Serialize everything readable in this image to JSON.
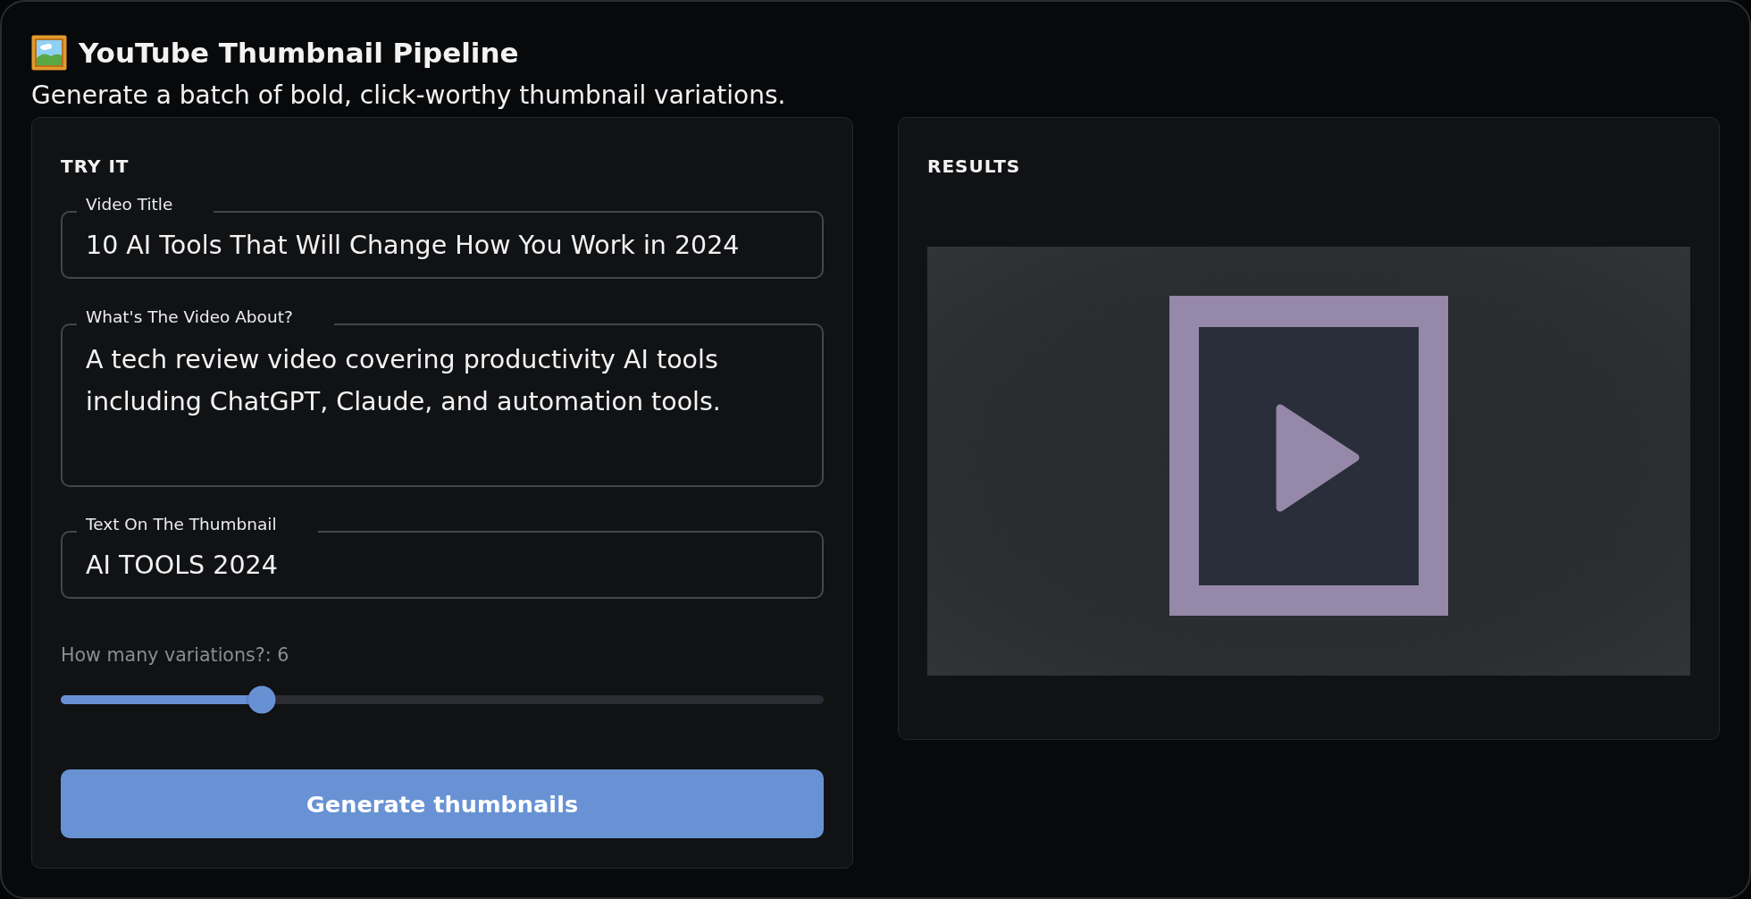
{
  "header": {
    "title": "YouTube Thumbnail Pipeline",
    "subtitle": "Generate a batch of bold, click-worthy thumbnail variations."
  },
  "form_panel": {
    "heading": "TRY IT",
    "fields": [
      {
        "kind": "text",
        "label": "Video Title",
        "value": "10 AI Tools That Will Change How You Work in 2024"
      },
      {
        "kind": "textarea",
        "label": "What's The Video About?",
        "value": "A tech review video covering productivity AI tools including ChatGPT, Claude, and automation tools."
      },
      {
        "kind": "text",
        "label": "Text On The Thumbnail",
        "value": "AI TOOLS 2024"
      }
    ],
    "slider": {
      "label": "How many variations?: 6",
      "level": 0.263
    },
    "button": "Generate thumbnails"
  },
  "results_panel": {
    "heading": "RESULTS"
  }
}
